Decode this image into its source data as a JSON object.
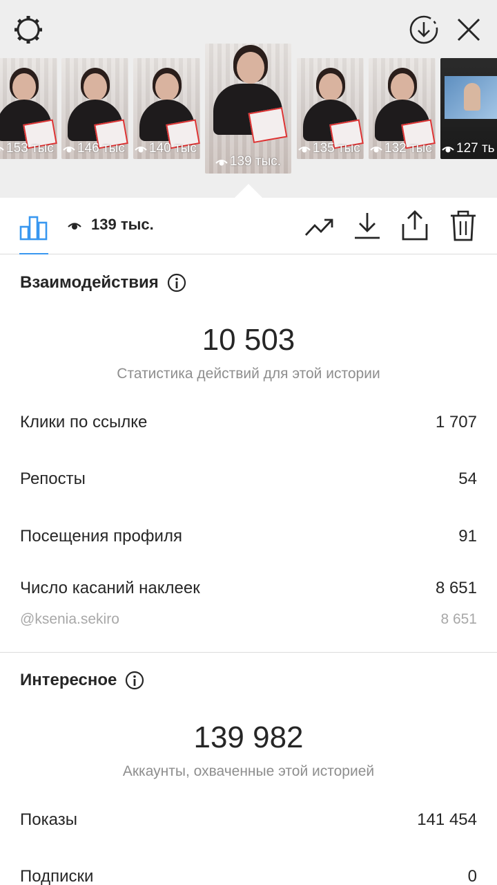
{
  "thumbnails": [
    {
      "views": "153 тыс"
    },
    {
      "views": "146 тыс"
    },
    {
      "views": "140 тыс"
    },
    {
      "views": "139 тыс.",
      "selected": true
    },
    {
      "views": "135 тыс"
    },
    {
      "views": "132 тыс"
    },
    {
      "views": "127 ть"
    }
  ],
  "toolbar": {
    "views": "139 тыс."
  },
  "interactions": {
    "title": "Взаимодействия",
    "total": "10 503",
    "subtitle": "Статистика действий для этой истории",
    "rows": [
      {
        "label": "Клики по ссылке",
        "value": "1 707"
      },
      {
        "label": "Репосты",
        "value": "54"
      },
      {
        "label": "Посещения профиля",
        "value": "91"
      },
      {
        "label": "Число касаний наклеек",
        "value": "8 651"
      }
    ],
    "sticker": {
      "label": "@ksenia.sekiro",
      "value": "8 651"
    }
  },
  "discovery": {
    "title": "Интересное",
    "total": "139 982",
    "subtitle": "Аккаунты, охваченные этой историей",
    "rows": [
      {
        "label": "Показы",
        "value": "141 454"
      },
      {
        "label": "Подписки",
        "value": "0"
      }
    ]
  },
  "colors": {
    "accent": "#3897f0",
    "text": "#262626",
    "secondary": "#8e8e8e",
    "top_bg": "#eeeeee"
  },
  "icons": [
    "settings-icon",
    "download-circle-icon",
    "close-icon",
    "eye-icon",
    "bar-chart-icon",
    "trending-icon",
    "download-icon",
    "share-icon",
    "trash-icon",
    "info-icon"
  ]
}
